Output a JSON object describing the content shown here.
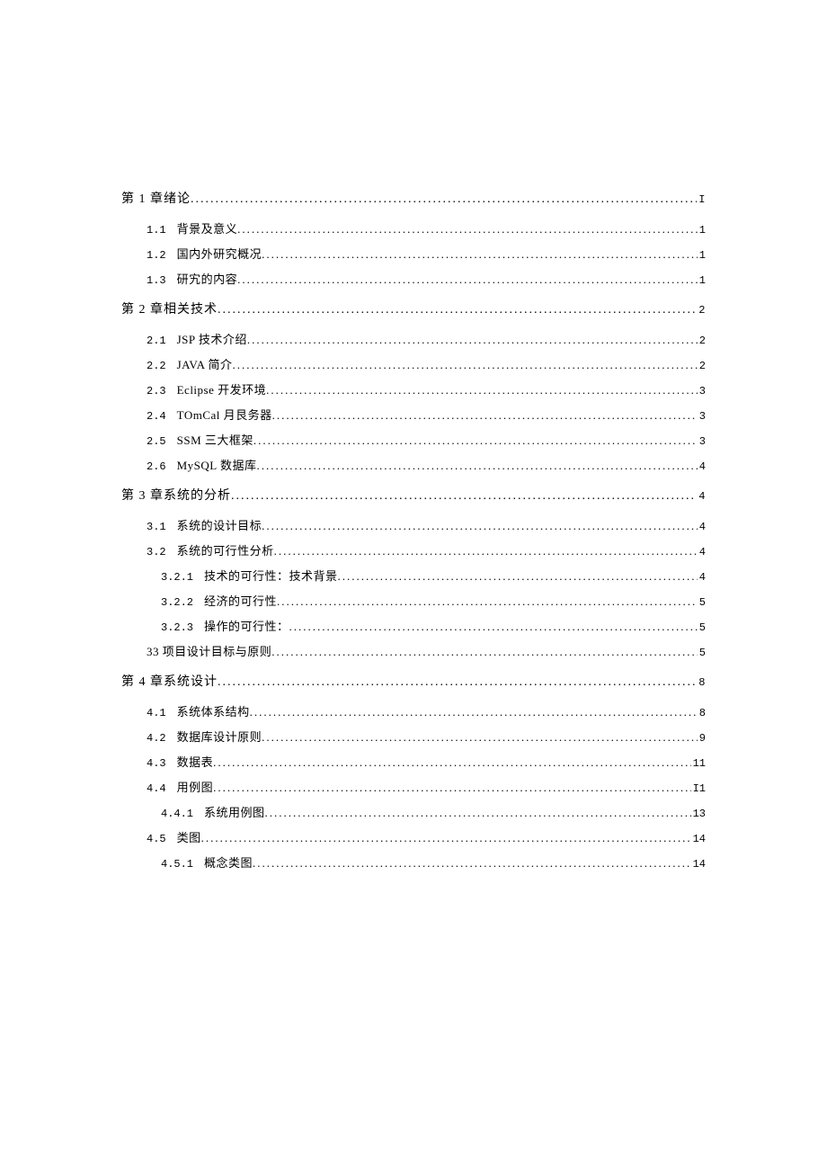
{
  "toc": [
    {
      "class": "chapter",
      "num": "第 1 章绪论",
      "numClass": "num-ch",
      "title": "",
      "page": "I"
    },
    {
      "class": "section",
      "num": "1.1",
      "title": "背景及意义",
      "page": "1"
    },
    {
      "class": "section",
      "num": "1.2",
      "title": "国内外研究概况",
      "page": "1"
    },
    {
      "class": "section",
      "num": "1.3",
      "title": "研宄的内容",
      "page": "1"
    },
    {
      "class": "chapter",
      "num": "第 2 章相关技术",
      "numClass": "num-ch",
      "title": "",
      "page": "2"
    },
    {
      "class": "section",
      "num": "2.1",
      "title": "JSP 技术介绍",
      "titleClass": "mixed",
      "page": "2"
    },
    {
      "class": "section",
      "num": "2.2",
      "title": "JAVA 简介",
      "titleClass": "mixed",
      "page": "2"
    },
    {
      "class": "section",
      "num": "2.3",
      "title": "Eclipse 开发环境",
      "titleClass": "mixed",
      "page": "3"
    },
    {
      "class": "section",
      "num": "2.4",
      "title": "TOmCal 月艮务器",
      "titleClass": "mixed",
      "page": "3"
    },
    {
      "class": "section",
      "num": "2.5",
      "title": "SSM 三大框架",
      "titleClass": "mixed",
      "page": "3"
    },
    {
      "class": "section",
      "num": "2.6",
      "title": "MySQL 数据库",
      "titleClass": "mixed",
      "page": "4"
    },
    {
      "class": "chapter",
      "num": "第 3 章系统的分析",
      "numClass": "num-ch",
      "title": "",
      "page": "4"
    },
    {
      "class": "section",
      "num": "3.1",
      "title": "系统的设计目标",
      "page": "4"
    },
    {
      "class": "section",
      "num": "3.2",
      "title": "系统的可行性分析",
      "page": "4"
    },
    {
      "class": "subsection",
      "num": "3.2.1",
      "title": "技术的可行性：技术背景",
      "page": "4"
    },
    {
      "class": "subsection",
      "num": "3.2.2",
      "title": "经济的可行性",
      "page": "5"
    },
    {
      "class": "subsection",
      "num": "3.2.3",
      "title": "操作的可行性：",
      "page": "5"
    },
    {
      "class": "special",
      "num": "33 项目设计目标与原则",
      "numClass": "",
      "title": "",
      "page": "5"
    },
    {
      "class": "chapter",
      "num": "第 4 章系统设计",
      "numClass": "num-ch",
      "title": "",
      "page": "8"
    },
    {
      "class": "section",
      "num": "4.1",
      "title": "系统体系结构",
      "page": "8"
    },
    {
      "class": "section",
      "num": "4.2",
      "title": "数据库设计原则",
      "page": "9"
    },
    {
      "class": "section",
      "num": "4.3",
      "title": "数据表",
      "page": "11"
    },
    {
      "class": "section",
      "num": "4.4",
      "title": "用例图",
      "page": "I1"
    },
    {
      "class": "subsection",
      "num": "4.4.1",
      "title": "系统用例图",
      "page": "13"
    },
    {
      "class": "section",
      "num": "4.5",
      "title": "类图",
      "page": "14"
    },
    {
      "class": "subsection",
      "num": "4.5.1",
      "title": "概念类图",
      "page": "14"
    }
  ]
}
